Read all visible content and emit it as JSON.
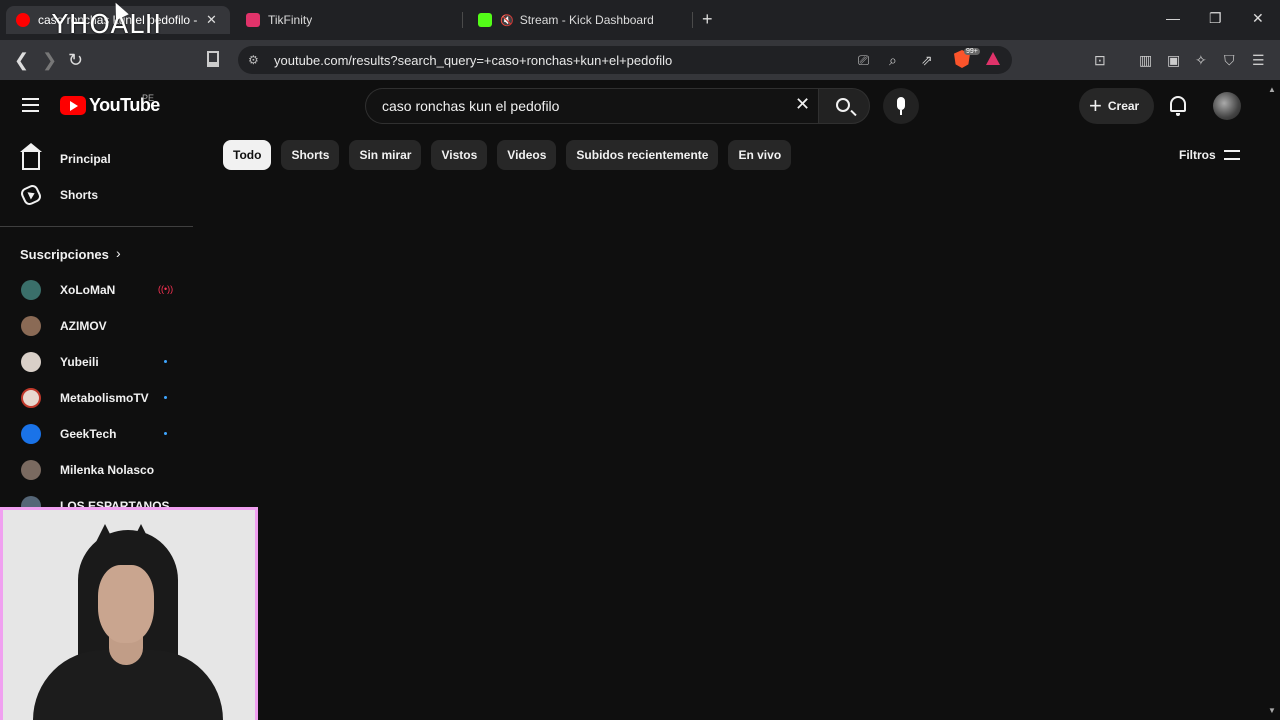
{
  "browser": {
    "tabs": [
      {
        "title": "caso ronchas kun el pedofilo - YouTube",
        "favicon_color": "#ff0000",
        "active": true
      },
      {
        "title": "TikFinity",
        "favicon_color": "#e0336a",
        "active": false
      },
      {
        "title": "Stream - Kick Dashboard",
        "favicon_color": "#53fc18",
        "active": false
      }
    ],
    "overlay_name": "YHOALII",
    "url": "youtube.com/results?search_query=+caso+ronchas+kun+el+pedofilo",
    "extension_badge": "99+"
  },
  "youtube": {
    "logo_text": "YouTube",
    "country_code": "PE",
    "search_query": "caso ronchas kun el pedofilo",
    "create_label": "Crear",
    "chips": [
      "Todo",
      "Shorts",
      "Sin mirar",
      "Vistos",
      "Videos",
      "Subidos recientemente",
      "En vivo"
    ],
    "filters_label": "Filtros",
    "sidebar": {
      "nav": [
        {
          "label": "Principal",
          "icon": "home-icon"
        },
        {
          "label": "Shorts",
          "icon": "shorts-icon"
        }
      ],
      "subscriptions_title": "Suscripciones",
      "subscriptions": [
        {
          "name": "XoLoMaN",
          "avatar_color": "#3a6f6a",
          "status": "live"
        },
        {
          "name": "AZIMOV",
          "avatar_color": "#8a6a55",
          "status": "none"
        },
        {
          "name": "Yubeili",
          "avatar_color": "#d9d0c8",
          "status": "new"
        },
        {
          "name": "MetabolismoTV",
          "avatar_color": "#e8d8cf",
          "status": "new"
        },
        {
          "name": "GeekTech",
          "avatar_color": "#1a73e8",
          "status": "new"
        },
        {
          "name": "Milenka Nolasco",
          "avatar_color": "#7a6a60",
          "status": "none"
        },
        {
          "name": "LOS ESPARTANOS",
          "avatar_color": "#556677",
          "status": "none"
        }
      ]
    }
  }
}
